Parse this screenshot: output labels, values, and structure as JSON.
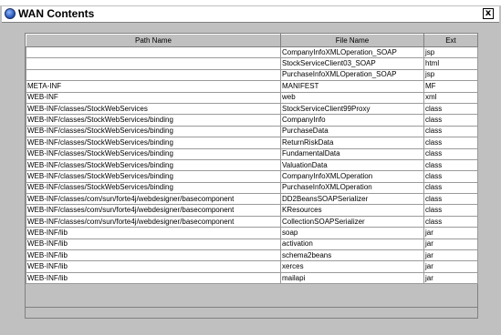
{
  "window": {
    "title": "WAN Contents",
    "close_glyph": "x",
    "app_icon": "globe-icon"
  },
  "table": {
    "headers": [
      "Path Name",
      "File Name",
      "Ext"
    ],
    "rows": [
      [
        "",
        "CompanyInfoXMLOperation_SOAP",
        "jsp"
      ],
      [
        "",
        "StockServiceClient03_SOAP",
        "html"
      ],
      [
        "",
        "PurchaseInfoXMLOperation_SOAP",
        "jsp"
      ],
      [
        "META-INF",
        "MANIFEST",
        "MF"
      ],
      [
        "WEB-INF",
        "web",
        "xml"
      ],
      [
        "WEB-INF/classes/StockWebServices",
        "StockServiceClient99Proxy",
        "class"
      ],
      [
        "WEB-INF/classes/StockWebServices/binding",
        "CompanyInfo",
        "class"
      ],
      [
        "WEB-INF/classes/StockWebServices/binding",
        "PurchaseData",
        "class"
      ],
      [
        "WEB-INF/classes/StockWebServices/binding",
        "ReturnRiskData",
        "class"
      ],
      [
        "WEB-INF/classes/StockWebServices/binding",
        "FundamentalData",
        "class"
      ],
      [
        "WEB-INF/classes/StockWebServices/binding",
        "ValuationData",
        "class"
      ],
      [
        "WEB-INF/classes/StockWebServices/binding",
        "CompanyInfoXMLOperation",
        "class"
      ],
      [
        "WEB-INF/classes/StockWebServices/binding",
        "PurchaseInfoXMLOperation",
        "class"
      ],
      [
        "WEB-INF/classes/com/sun/forte4j/webdesigner/basecomponent",
        "DD2BeansSOAPSerializer",
        "class"
      ],
      [
        "WEB-INF/classes/com/sun/forte4j/webdesigner/basecomponent",
        "KResources",
        "class"
      ],
      [
        "WEB-INF/classes/com/sun/forte4j/webdesigner/basecomponent",
        "CollectionSOAPSerializer",
        "class"
      ],
      [
        "WEB-INF/lib",
        "soap",
        "jar"
      ],
      [
        "WEB-INF/lib",
        "activation",
        "jar"
      ],
      [
        "WEB-INF/lib",
        "schema2beans",
        "jar"
      ],
      [
        "WEB-INF/lib",
        "xerces",
        "jar"
      ],
      [
        "WEB-INF/lib",
        "mailapi",
        "jar"
      ]
    ]
  }
}
